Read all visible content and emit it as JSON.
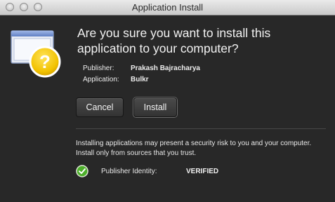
{
  "window": {
    "title": "Application Install"
  },
  "dialog": {
    "headline": "Are you sure you want to install this application to your computer?",
    "publisher_label": "Publisher:",
    "publisher_value": "Prakash Bajracharya",
    "application_label": "Application:",
    "application_value": "Bulkr",
    "warning_text": "Installing applications may present a security risk to you and your computer. Install only from sources that you trust.",
    "identity_label": "Publisher Identity:",
    "identity_value": "VERIFIED",
    "icon": "question-mark-window-icon",
    "verified_icon": "green-check-icon"
  },
  "buttons": {
    "cancel_label": "Cancel",
    "install_label": "Install"
  },
  "colors": {
    "background": "#282828",
    "warning_yellow": "#f2c200",
    "verified_green": "#4caf2a"
  }
}
